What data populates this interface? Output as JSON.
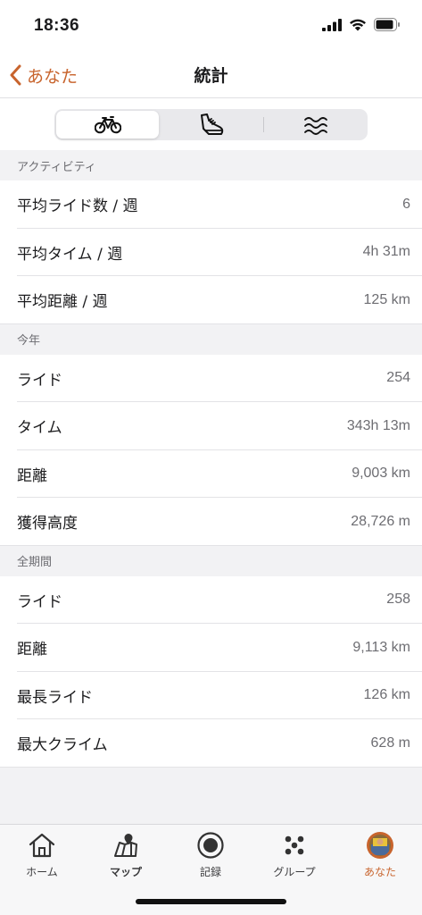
{
  "status": {
    "time": "18:36"
  },
  "nav": {
    "back_label": "あなた",
    "title": "統計"
  },
  "segments": [
    {
      "icon": "bike-icon",
      "active": true
    },
    {
      "icon": "shoe-icon",
      "active": false
    },
    {
      "icon": "swim-icon",
      "active": false
    }
  ],
  "sections": {
    "activity": {
      "header": "アクティビティ",
      "rows": [
        {
          "label": "平均ライド数 / 週",
          "value": "6"
        },
        {
          "label": "平均タイム / 週",
          "value": "4h 31m"
        },
        {
          "label": "平均距離 / 週",
          "value": "125 km"
        }
      ]
    },
    "this_year": {
      "header": "今年",
      "rows": [
        {
          "label": "ライド",
          "value": "254"
        },
        {
          "label": "タイム",
          "value": "343h 13m"
        },
        {
          "label": "距離",
          "value": "9,003 km"
        },
        {
          "label": "獲得高度",
          "value": "28,726 m"
        }
      ]
    },
    "all_time": {
      "header": "全期間",
      "rows": [
        {
          "label": "ライド",
          "value": "258"
        },
        {
          "label": "距離",
          "value": "9,113 km"
        },
        {
          "label": "最長ライド",
          "value": "126 km"
        },
        {
          "label": "最大クライム",
          "value": "628 m"
        }
      ]
    }
  },
  "tabs": [
    {
      "label": "ホーム",
      "icon": "home-icon"
    },
    {
      "label": "マップ",
      "icon": "map-icon"
    },
    {
      "label": "記録",
      "icon": "record-icon"
    },
    {
      "label": "グループ",
      "icon": "group-icon"
    },
    {
      "label": "あなた",
      "icon": "avatar-icon"
    }
  ],
  "colors": {
    "accent": "#c8642d",
    "background": "#f2f2f4"
  }
}
